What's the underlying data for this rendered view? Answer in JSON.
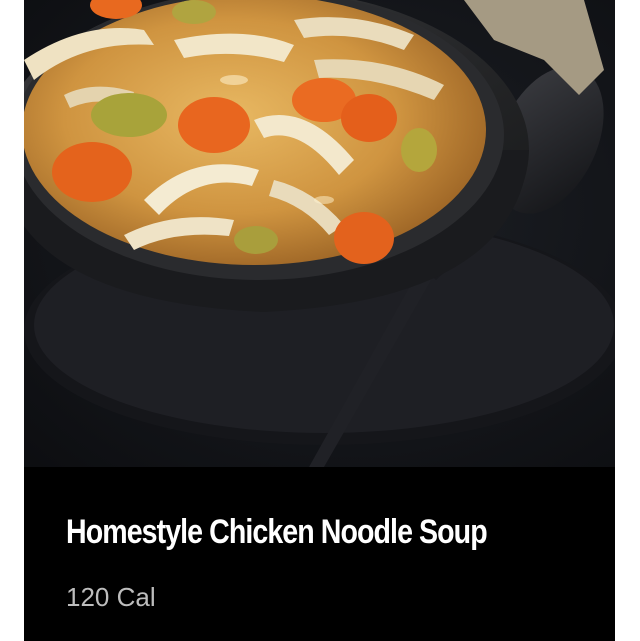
{
  "product": {
    "name": "Homestyle Chicken Noodle Soup",
    "calories": "120 Cal"
  },
  "colors": {
    "card_background": "#000000",
    "title_text": "#ffffff",
    "calorie_text": "#bdbdbd",
    "page_background": "#ffffff"
  }
}
